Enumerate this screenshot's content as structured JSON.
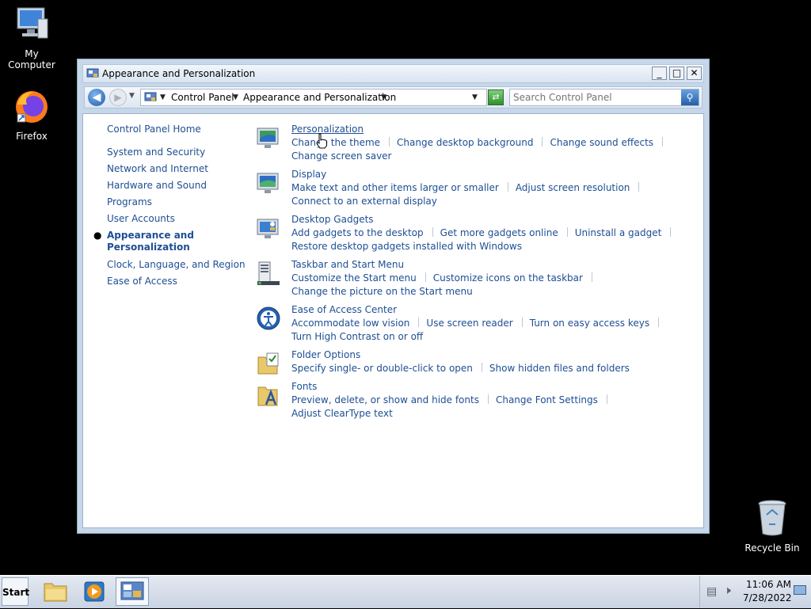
{
  "desktop": {
    "icons": [
      {
        "label": "My Computer"
      },
      {
        "label": "Firefox"
      },
      {
        "label": "Recycle Bin"
      }
    ]
  },
  "window": {
    "title": "Appearance and Personalization",
    "controls": {
      "minimize": "_",
      "maximize": "□",
      "close": "✕"
    }
  },
  "navbar": {
    "breadcrumb": [
      "Control Panel",
      "Appearance and Personalization"
    ],
    "search_placeholder": "Search Control Panel"
  },
  "sidebar": {
    "home": "Control Panel Home",
    "items": [
      "System and Security",
      "Network and Internet",
      "Hardware and Sound",
      "Programs",
      "User Accounts",
      "Appearance and Personalization",
      "Clock, Language, and Region",
      "Ease of Access"
    ],
    "current_index": 5
  },
  "categories": [
    {
      "title": "Personalization",
      "links": [
        "Change the theme",
        "Change desktop background",
        "Change sound effects",
        "Change screen saver"
      ]
    },
    {
      "title": "Display",
      "links": [
        "Make text and other items larger or smaller",
        "Adjust screen resolution",
        "Connect to an external display"
      ]
    },
    {
      "title": "Desktop Gadgets",
      "links": [
        "Add gadgets to the desktop",
        "Get more gadgets online",
        "Uninstall a gadget",
        "Restore desktop gadgets installed with Windows"
      ]
    },
    {
      "title": "Taskbar and Start Menu",
      "links": [
        "Customize the Start menu",
        "Customize icons on the taskbar",
        "Change the picture on the Start menu"
      ]
    },
    {
      "title": "Ease of Access Center",
      "links": [
        "Accommodate low vision",
        "Use screen reader",
        "Turn on easy access keys",
        "Turn High Contrast on or off"
      ]
    },
    {
      "title": "Folder Options",
      "links": [
        "Specify single- or double-click to open",
        "Show hidden files and folders"
      ]
    },
    {
      "title": "Fonts",
      "links": [
        "Preview, delete, or show and hide fonts",
        "Change Font Settings",
        "Adjust ClearType text"
      ]
    }
  ],
  "taskbar": {
    "start_label": "Start",
    "time": "11:06 AM",
    "date": "7/28/2022"
  },
  "colors": {
    "link": "#1e4e93",
    "window_frame": "#c6d7ea",
    "desktop": "#000000"
  }
}
